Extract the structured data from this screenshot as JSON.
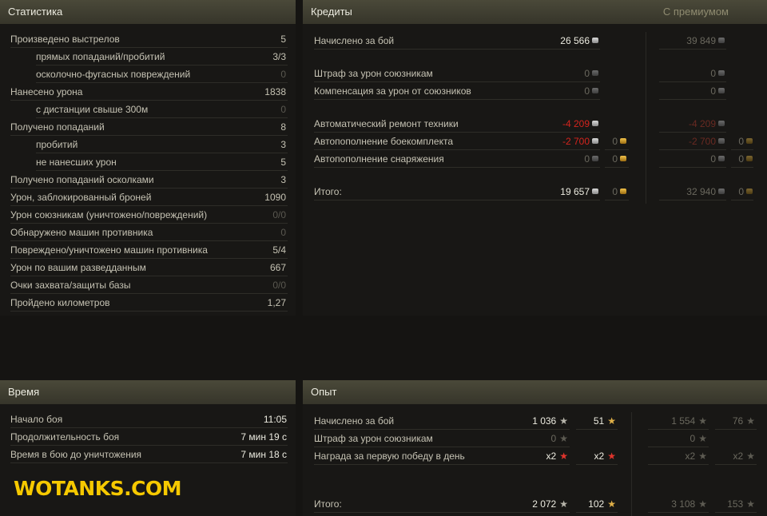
{
  "stats": {
    "title": "Статистика",
    "rows": [
      {
        "label": "Произведено выстрелов",
        "value": "5",
        "indent": false,
        "dim": false
      },
      {
        "label": "прямых попаданий/пробитий",
        "value": "3/3",
        "indent": true,
        "dim": false
      },
      {
        "label": "осколочно-фугасных повреждений",
        "value": "0",
        "indent": true,
        "dim": true
      },
      {
        "label": "Нанесено урона",
        "value": "1838",
        "indent": false,
        "dim": false
      },
      {
        "label": "с дистанции свыше 300м",
        "value": "0",
        "indent": true,
        "dim": true
      },
      {
        "label": "Получено попаданий",
        "value": "8",
        "indent": false,
        "dim": false
      },
      {
        "label": "пробитий",
        "value": "3",
        "indent": true,
        "dim": false
      },
      {
        "label": "не нанесших урон",
        "value": "5",
        "indent": true,
        "dim": false
      },
      {
        "label": "Получено попаданий осколками",
        "value": "3",
        "indent": false,
        "dim": false
      },
      {
        "label": "Урон, заблокированный броней",
        "value": "1090",
        "indent": false,
        "dim": false
      },
      {
        "label": "Урон союзникам (уничтожено/повреждений)",
        "value": "0/0",
        "indent": false,
        "dim": true
      },
      {
        "label": "Обнаружено машин противника",
        "value": "0",
        "indent": false,
        "dim": true
      },
      {
        "label": "Повреждено/уничтожено машин противника",
        "value": "5/4",
        "indent": false,
        "dim": false
      },
      {
        "label": "Урон по вашим разведданным",
        "value": "667",
        "indent": false,
        "dim": false
      },
      {
        "label": "Очки захвата/защиты базы",
        "value": "0/0",
        "indent": false,
        "dim": true
      },
      {
        "label": "Пройдено километров",
        "value": "1,27",
        "indent": false,
        "dim": false
      }
    ]
  },
  "credits": {
    "title": "Кредиты",
    "premium_title": "С премиумом",
    "rows": [
      {
        "label": "Начислено за бой",
        "c": "26 566",
        "g": "",
        "pc": "39 849",
        "pg": "",
        "style": "bright"
      },
      {
        "label": "Штраф за урон союзникам",
        "c": "0",
        "g": "",
        "pc": "0",
        "pg": "",
        "style": "dim"
      },
      {
        "label": "Компенсация за урон от союзников",
        "c": "0",
        "g": "",
        "pc": "0",
        "pg": "",
        "style": "dim"
      },
      {
        "label": "Автоматический ремонт техники",
        "c": "-4 209",
        "g": "",
        "pc": "-4 209",
        "pg": "",
        "style": "red"
      },
      {
        "label": "Автопополнение боекомплекта",
        "c": "-2 700",
        "g": "0",
        "pc": "-2 700",
        "pg": "0",
        "style": "red"
      },
      {
        "label": "Автопополнение снаряжения",
        "c": "0",
        "g": "0",
        "pc": "0",
        "pg": "0",
        "style": "dim"
      },
      {
        "label": "Итого:",
        "c": "19 657",
        "g": "0",
        "pc": "32 940",
        "pg": "0",
        "style": "bright"
      }
    ]
  },
  "time": {
    "title": "Время",
    "rows": [
      {
        "label": "Начало боя",
        "value": "11:05"
      },
      {
        "label": "Продолжительность боя",
        "value": "7 мин 19 с"
      },
      {
        "label": "Время в бою до уничтожения",
        "value": "7 мин 18 с"
      }
    ]
  },
  "xp": {
    "title": "Опыт",
    "rows": [
      {
        "label": "Начислено за бой",
        "xp": "1 036",
        "fxp": "51",
        "pxp": "1 554",
        "pfxp": "76",
        "style": "bright"
      },
      {
        "label": "Штраф за урон союзникам",
        "xp": "0",
        "fxp": "",
        "pxp": "0",
        "pfxp": "",
        "style": "dim"
      },
      {
        "label": "Награда за первую победу в день",
        "xp": "x2",
        "fxp": "x2",
        "pxp": "x2",
        "pfxp": "x2",
        "style": "mult"
      },
      {
        "label": "Итого:",
        "xp": "2 072",
        "fxp": "102",
        "pxp": "3 108",
        "pfxp": "153",
        "style": "bright"
      }
    ]
  },
  "watermark": "WOTANKS.COM"
}
